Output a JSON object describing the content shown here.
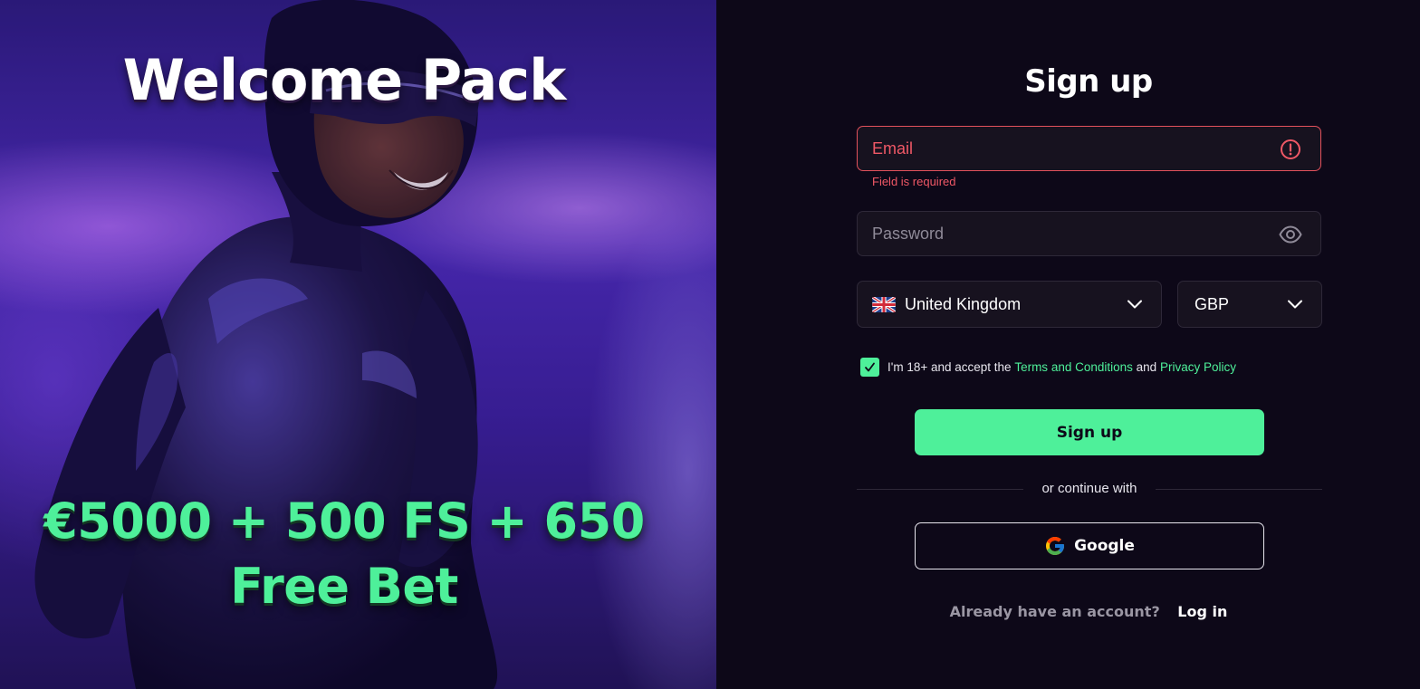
{
  "promo": {
    "title": "Welcome Pack",
    "offer_line1": "€5000 + 500 FS + 650",
    "offer_line2": "Free Bet"
  },
  "signup": {
    "title": "Sign up",
    "email": {
      "placeholder": "Email",
      "value": "",
      "error": "Field is required",
      "trailing_icon": "alert-circle-icon"
    },
    "password": {
      "placeholder": "Password",
      "value": "",
      "trailing_icon": "eye-icon"
    },
    "country": {
      "flag": "uk-flag-icon",
      "value": "United Kingdom"
    },
    "currency": {
      "value": "GBP"
    },
    "consent": {
      "checked": true,
      "text_before": "I'm 18+ and accept the",
      "terms_link": "Terms and Conditions",
      "text_middle": "and",
      "privacy_link": "Privacy Policy"
    },
    "submit_label": "Sign up",
    "divider_text": "or continue with",
    "google_label": "Google",
    "login_prompt": "Already have an account?",
    "login_link": "Log in"
  },
  "colors": {
    "accent": "#4ef09a",
    "error": "#f05866",
    "background": "#0d0818",
    "field_bg": "#17121f"
  }
}
